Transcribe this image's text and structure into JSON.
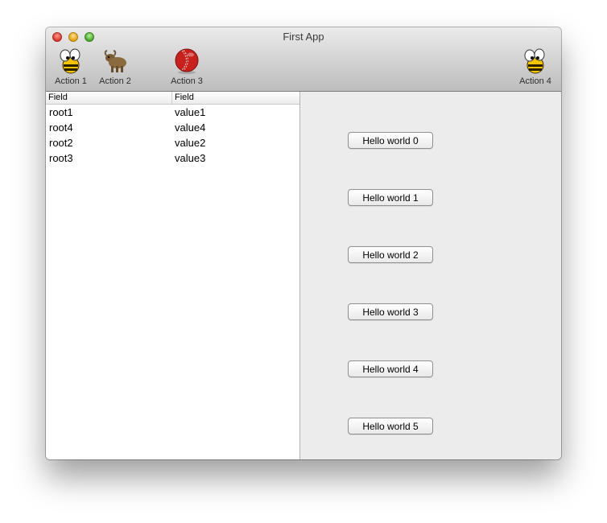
{
  "window": {
    "title": "First App"
  },
  "toolbar": {
    "items": [
      {
        "label": "Action 1",
        "icon": "bee-icon"
      },
      {
        "label": "Action 2",
        "icon": "yak-icon"
      },
      {
        "label": "Action 3",
        "icon": "ball-icon"
      },
      {
        "label": "Action 4",
        "icon": "bee-icon"
      }
    ]
  },
  "table": {
    "headers": [
      "Field",
      "Field"
    ],
    "rows": [
      [
        "root1",
        "value1"
      ],
      [
        "root4",
        "value4"
      ],
      [
        "root2",
        "value2"
      ],
      [
        "root3",
        "value3"
      ]
    ]
  },
  "buttons": [
    "Hello world 0",
    "Hello world 1",
    "Hello world 2",
    "Hello world 3",
    "Hello world 4",
    "Hello world 5"
  ],
  "colors": {
    "ball_red": "#c8201c",
    "bee_yellow": "#f5c400"
  }
}
